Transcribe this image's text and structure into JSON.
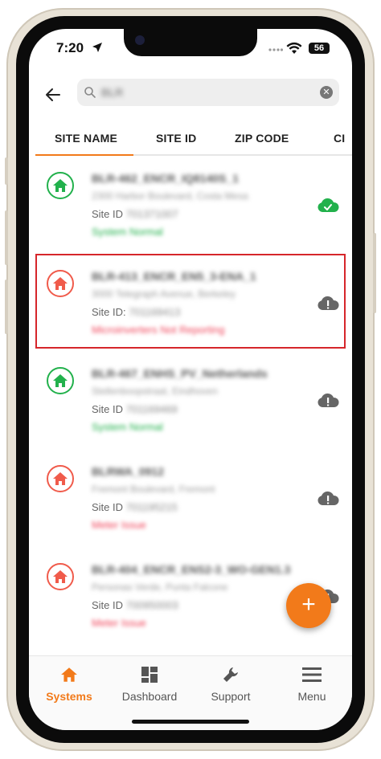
{
  "status_bar": {
    "time": "7:20",
    "battery": "56"
  },
  "search": {
    "value": "BLR"
  },
  "tabs": [
    {
      "label": "SITE NAME"
    },
    {
      "label": "SITE ID"
    },
    {
      "label": "ZIP CODE"
    },
    {
      "label": "CI"
    }
  ],
  "site_id_label": "Site ID",
  "site_id_label_colon": "Site ID:",
  "sites": [
    {
      "name": "BLR-462_ENCR_IQ8140S_1",
      "address": "2300 Harbor Boulevard, Costa Mesa",
      "site_id": "701371007",
      "status": "System Normal",
      "home_color": "#22b14c",
      "cloud": "ok"
    },
    {
      "name": "BLR-413_ENCR_EN5_3-ENA_1",
      "address": "3000 Telegraph Avenue, Berkeley",
      "site_id": "701169413",
      "status": "Microinverters Not Reporting",
      "home_color": "#f05b4b",
      "cloud": "alert"
    },
    {
      "name": "BLR-467_ENHS_PV_Netherlands",
      "address": "Stellenboopstraat, Eindhoven",
      "site_id": "701169469",
      "status": "System Normal",
      "home_color": "#22b14c",
      "cloud": "alert"
    },
    {
      "name": "BLRWA_0912",
      "address": "Fremont Boulevard, Fremont",
      "site_id": "701195215",
      "status": "Meter Issue",
      "home_color": "#f05b4b",
      "cloud": "alert"
    },
    {
      "name": "BLR-404_ENCR_ENS2-3_WO-GEN1.3",
      "address": "Personas Verde, Punta Falcone",
      "site_id": "700950003",
      "status": "Meter Issue",
      "home_color": "#f05b4b",
      "cloud": "alert"
    }
  ],
  "fab": {
    "label": "+"
  },
  "bottom_nav": [
    {
      "label": "Systems",
      "active": true
    },
    {
      "label": "Dashboard",
      "active": false
    },
    {
      "label": "Support",
      "active": false
    },
    {
      "label": "Menu",
      "active": false
    }
  ],
  "colors": {
    "accent": "#f27a1a",
    "ok": "#22b14c",
    "alert": "#f05b4b",
    "highlight": "#d6262b"
  }
}
